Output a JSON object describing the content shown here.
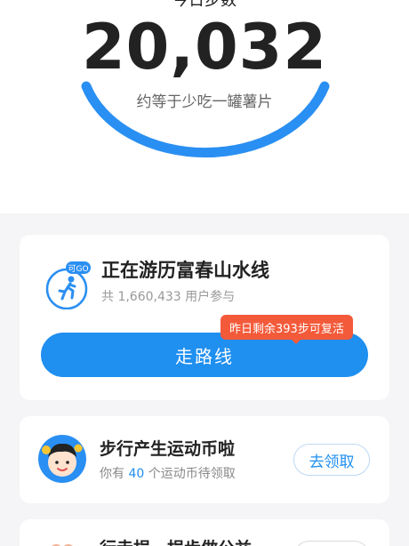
{
  "header": {
    "cut_label": "今日步数",
    "steps": "20,032",
    "subtitle": "约等于少吃一罐薯片"
  },
  "route_card": {
    "badge": "可GO",
    "title": "正在游历富春山水线",
    "participants": "共 1,660,433 用户参与",
    "tip": "昨日剩余393步可复活",
    "button": "走路线"
  },
  "coin_card": {
    "title": "步行产生运动币啦",
    "desc_prefix": "你有",
    "count": "40",
    "desc_suffix": "个运动币待领取",
    "button": "去领取"
  },
  "next_card": {
    "title": "行走捐，捐步做公益"
  },
  "colors": {
    "accent": "#1f8ff0",
    "tip": "#f35a3a"
  }
}
